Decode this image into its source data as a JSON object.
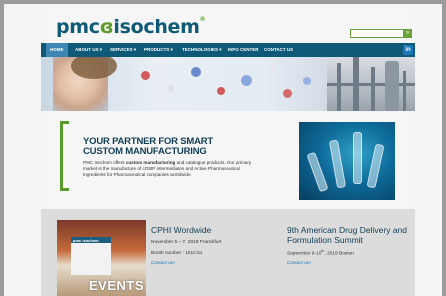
{
  "logo": {
    "left": "pmc",
    "mark": "ɞ",
    "right": "isochem",
    "tm": "®"
  },
  "search": {
    "placeholder": "",
    "go_label": "»"
  },
  "nav": {
    "items": [
      {
        "label": "HOME"
      },
      {
        "label": "ABOUT US ▾"
      },
      {
        "label": "SERVICES ▾"
      },
      {
        "label": "PRODUCTS ▾"
      },
      {
        "label": "TECHNOLOGIES ▾"
      },
      {
        "label": "INFO CENTER"
      },
      {
        "label": "CONTACT US"
      }
    ],
    "linkedin": "in"
  },
  "partner": {
    "title_line1": "YOUR PARTNER FOR SMART",
    "title_line2": "CUSTOM MANUFACTURING",
    "text_pre": "PMC Isochem offers ",
    "text_bold": "custom manufacturing",
    "text_post": " and catalogue products. Our primary market is the manufacture of cGMP Intermediates and Active Pharmaceutical Ingredients for Pharmaceutical companies worldwide."
  },
  "events": {
    "image_label": "EVENTS",
    "booth_sign": "pmc isochem",
    "cphi": {
      "title": "CPHI Wordwide",
      "date": "November 5 – 7, 2019 Franckfurt",
      "booth": "Booth number : 101CS1",
      "link": "Contact us»"
    },
    "adds": {
      "title_line1": "9th American Drug Delivery and",
      "title_line2": "Formulation Summit",
      "date_pre": "September 9-10",
      "date_sup": "th",
      "date_post": ", 2019 Boston",
      "link": "Contact us»"
    }
  },
  "colors": {
    "brand_blue": "#0f5978",
    "brand_green": "#5a9a2a",
    "link_blue": "#1b76b6"
  }
}
